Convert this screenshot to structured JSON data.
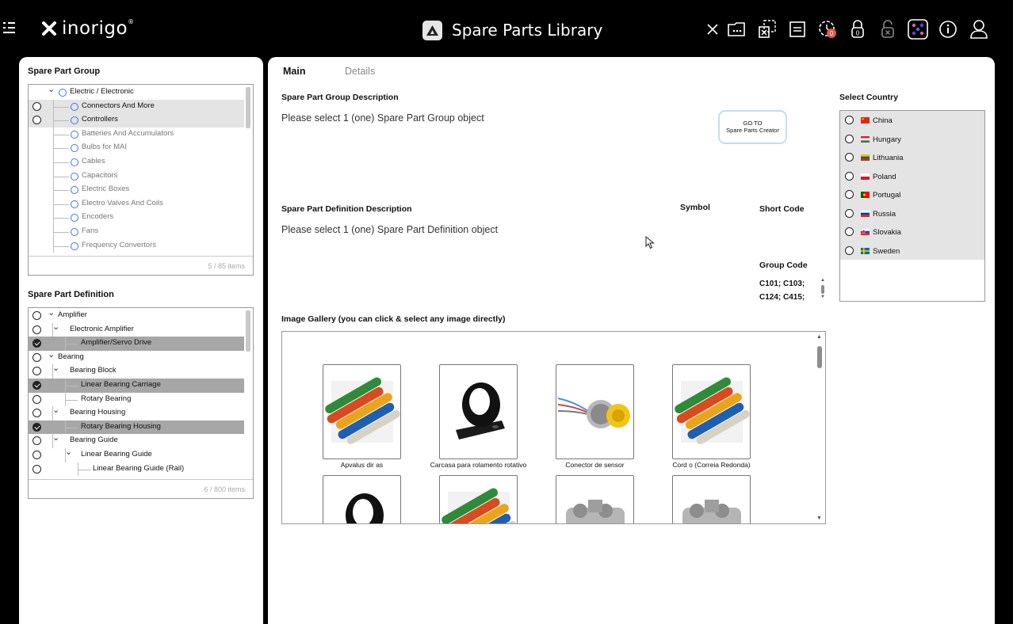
{
  "topbar": {
    "logo_text": "inorigo",
    "logo_reg": "®",
    "app_title": "Spare Parts Library",
    "notification_badge": "0",
    "icons": [
      "close-icon",
      "folder-icon",
      "select-area-icon",
      "document-icon",
      "clock-badge-icon",
      "lock-0-icon",
      "unlock-icon",
      "apps-grid-icon",
      "info-icon",
      "user-icon"
    ]
  },
  "spare_part_group": {
    "title": "Spare Part Group",
    "footer": "5 / 85 items",
    "items": [
      {
        "label": "Electric / Electronic",
        "level": 0,
        "expanded": true,
        "radio": false,
        "state": "normal",
        "grey": false
      },
      {
        "label": "Connectors And More",
        "level": 1,
        "radio": true,
        "state": "highlight",
        "grey": false
      },
      {
        "label": "Controllers",
        "level": 1,
        "radio": true,
        "state": "highlight",
        "grey": false
      },
      {
        "label": "Batteries And Accumulators",
        "level": 1,
        "radio": false,
        "state": "normal",
        "grey": true
      },
      {
        "label": "Bulbs for MAI",
        "level": 1,
        "radio": false,
        "state": "normal",
        "grey": true
      },
      {
        "label": "Cables",
        "level": 1,
        "radio": false,
        "state": "normal",
        "grey": true
      },
      {
        "label": "Capacitors",
        "level": 1,
        "radio": false,
        "state": "normal",
        "grey": true
      },
      {
        "label": "Electric Boxes",
        "level": 1,
        "radio": false,
        "state": "normal",
        "grey": true
      },
      {
        "label": "Electro Valves And Coils",
        "level": 1,
        "radio": false,
        "state": "normal",
        "grey": true
      },
      {
        "label": "Encoders",
        "level": 1,
        "radio": false,
        "state": "normal",
        "grey": true
      },
      {
        "label": "Fans",
        "level": 1,
        "radio": false,
        "state": "normal",
        "grey": true
      },
      {
        "label": "Frequency Convertors",
        "level": 1,
        "radio": false,
        "state": "normal",
        "grey": true
      }
    ]
  },
  "spare_part_definition": {
    "title": "Spare Part Definition",
    "footer": "6 / 800 items",
    "items": [
      {
        "label": "Amplifier",
        "level": 0,
        "chevron": true,
        "checked": false,
        "selected": false
      },
      {
        "label": "Electronic Amplifier",
        "level": 1,
        "chevron": true,
        "checked": false,
        "selected": false
      },
      {
        "label": "Amplifier/Servo Drive",
        "level": 2,
        "chevron": false,
        "checked": true,
        "selected": true
      },
      {
        "label": "Bearing",
        "level": 0,
        "chevron": true,
        "checked": false,
        "selected": false
      },
      {
        "label": "Bearing Block",
        "level": 1,
        "chevron": true,
        "checked": false,
        "selected": false
      },
      {
        "label": "Linear Bearing Carriage",
        "level": 2,
        "chevron": false,
        "checked": true,
        "selected": true
      },
      {
        "label": "Rotary Bearing",
        "level": 2,
        "chevron": false,
        "checked": false,
        "selected": false
      },
      {
        "label": "Bearing Housing",
        "level": 1,
        "chevron": true,
        "checked": false,
        "selected": false
      },
      {
        "label": "Rotary Bearing Housing",
        "level": 2,
        "chevron": false,
        "checked": true,
        "selected": true
      },
      {
        "label": "Bearing Guide",
        "level": 1,
        "chevron": true,
        "checked": false,
        "selected": false
      },
      {
        "label": "Linear Bearing Guide",
        "level": 2,
        "chevron": true,
        "checked": false,
        "selected": false
      },
      {
        "label": "Linear Bearing Guide (Rail)",
        "level": 3,
        "chevron": false,
        "checked": false,
        "selected": false
      }
    ]
  },
  "tabs": {
    "main": "Main",
    "details": "Details"
  },
  "main": {
    "group_desc_label": "Spare Part Group Description",
    "group_desc_placeholder": "Please select 1 (one) Spare Part Group object",
    "goto_line1": "GO TO",
    "goto_line2": "Spare Parts Creator",
    "def_desc_label": "Spare Part Definition Description",
    "def_desc_placeholder": "Please select 1 (one) Spare Part Definition object",
    "symbol_label": "Symbol",
    "short_code_label": "Short Code",
    "group_code_label": "Group Code",
    "group_code_line1": "C101; C103;",
    "group_code_line2": "C124; C415;",
    "gallery_label": "Image Gallery (you can click & select any image directly)"
  },
  "gallery": {
    "items": [
      {
        "caption": "Apvalus dir as",
        "image": "colored-round-belts"
      },
      {
        "caption": "Carcasa para rolamento rotativo",
        "image": "black-bearing-housing"
      },
      {
        "caption": "Conector de sensor",
        "image": "sensor-connector"
      },
      {
        "caption": "Cord o (Correia Redonda)",
        "image": "colored-round-belts"
      },
      {
        "caption": "",
        "image": "black-bearing-housing"
      },
      {
        "caption": "",
        "image": "colored-round-belts"
      },
      {
        "caption": "",
        "image": "metal-motor"
      },
      {
        "caption": "",
        "image": "metal-motor"
      }
    ]
  },
  "country": {
    "title": "Select Country",
    "items": [
      {
        "name": "China",
        "flag": "china"
      },
      {
        "name": "Hungary",
        "flag": "hungary"
      },
      {
        "name": "Lithuania",
        "flag": "lithuania"
      },
      {
        "name": "Poland",
        "flag": "poland"
      },
      {
        "name": "Portugal",
        "flag": "portugal"
      },
      {
        "name": "Russia",
        "flag": "russia"
      },
      {
        "name": "Slovakia",
        "flag": "slovakia"
      },
      {
        "name": "Sweden",
        "flag": "sweden"
      }
    ]
  },
  "colors": {
    "accent": "#4a6fe8",
    "selected_row": "#a7a7a7",
    "highlight_row": "#e4e4e4",
    "badge": "#e05a4f",
    "apps_grid": "#6a3fd8"
  }
}
